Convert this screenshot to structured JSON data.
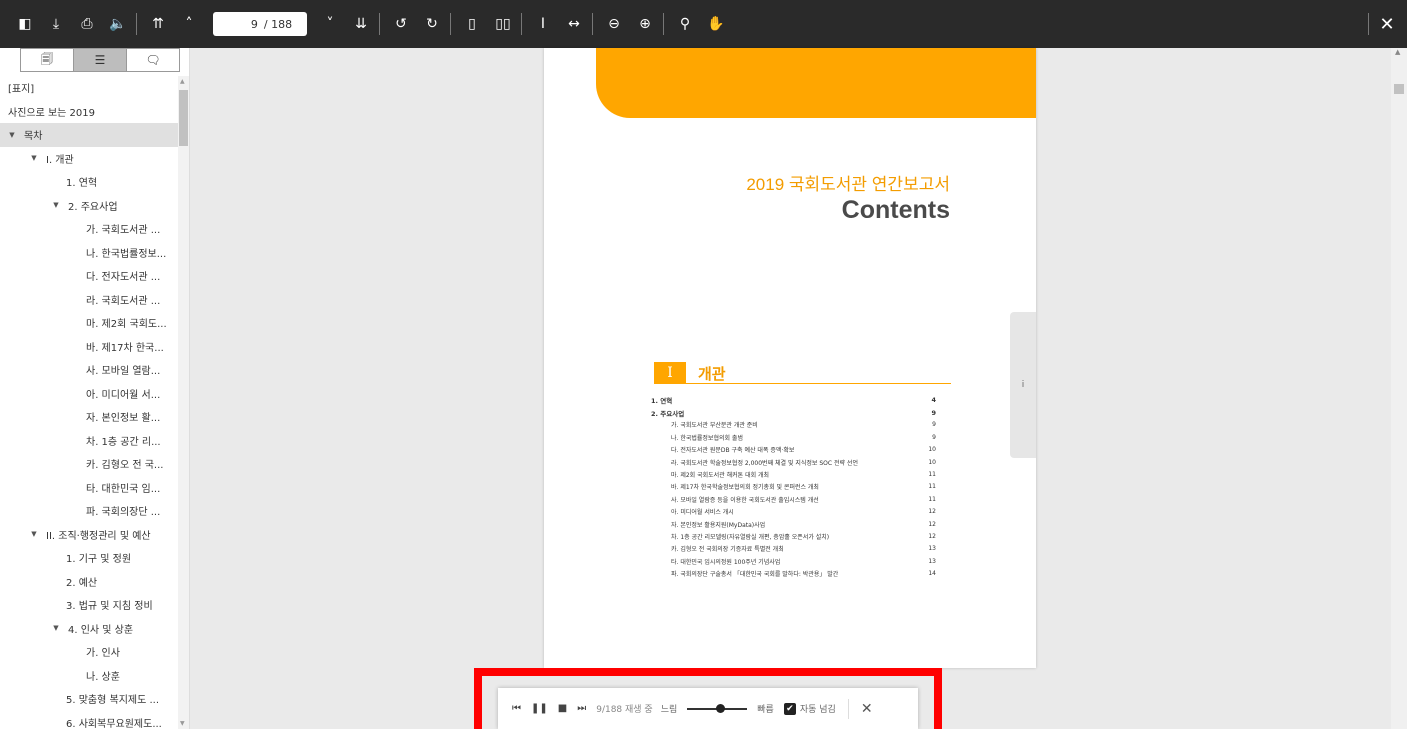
{
  "toolbar": {
    "page_current": "9",
    "page_total": "/ 188",
    "left_icons": [
      "sidebar-toggle-icon",
      "download-icon",
      "print-icon",
      "speaker-icon",
      "first-page-icon",
      "previous-page-icon"
    ],
    "right_icons": [
      "next-page-icon",
      "last-page-icon",
      "rotate-counterclockwise-icon",
      "rotate-clockwise-icon",
      "single-page-icon",
      "two-page-icon",
      "fit-height-icon",
      "fit-width-icon",
      "zoom-out-icon",
      "zoom-in-icon",
      "search-icon",
      "hand-tool-icon"
    ],
    "glyphs": {
      "sidebar-toggle-icon": "◧",
      "download-icon": "⤓",
      "print-icon": "⎙",
      "speaker-icon": "🔈",
      "first-page-icon": "⇈",
      "previous-page-icon": "˄",
      "next-page-icon": "˅",
      "last-page-icon": "⇊",
      "rotate-counterclockwise-icon": "↺",
      "rotate-clockwise-icon": "↻",
      "single-page-icon": "▯",
      "two-page-icon": "▯▯",
      "fit-height-icon": "Ⅰ",
      "fit-width-icon": "↔",
      "zoom-out-icon": "⊖",
      "zoom-in-icon": "⊕",
      "search-icon": "⚲",
      "hand-tool-icon": "✋"
    },
    "close_icon": "✕"
  },
  "sidebar": {
    "tabs": [
      {
        "name": "thumbnails-tab-icon",
        "glyph": "🗐"
      },
      {
        "name": "outline-tab-icon",
        "glyph": "☰",
        "active": true
      },
      {
        "name": "annotations-tab-icon",
        "glyph": "🗨"
      }
    ],
    "items": [
      {
        "label": "[표지]",
        "level": 0
      },
      {
        "label": "사진으로 보는 2019",
        "level": 0
      },
      {
        "label": "목차",
        "level": 0,
        "caret": true,
        "selected": true
      },
      {
        "label": "I. 개관",
        "level": 1,
        "caret": true
      },
      {
        "label": "1. 연혁",
        "level": 3
      },
      {
        "label": "2. 주요사업",
        "level": 2,
        "caret": true
      },
      {
        "label": "가. 국회도서관 ...",
        "level": 4
      },
      {
        "label": "나. 한국법률정보...",
        "level": 4
      },
      {
        "label": "다. 전자도서관 ...",
        "level": 4
      },
      {
        "label": "라. 국회도서관 ...",
        "level": 4
      },
      {
        "label": "마. 제2회 국회도...",
        "level": 4
      },
      {
        "label": "바. 제17차 한국...",
        "level": 4
      },
      {
        "label": "사. 모바일 열람...",
        "level": 4
      },
      {
        "label": "아. 미디어월 서...",
        "level": 4
      },
      {
        "label": "자. 본인정보 활...",
        "level": 4
      },
      {
        "label": "차. 1층 공간 리...",
        "level": 4
      },
      {
        "label": "카. 김형오 전 국...",
        "level": 4
      },
      {
        "label": "타. 대한민국 임...",
        "level": 4
      },
      {
        "label": "파. 국회의장단 ...",
        "level": 4
      },
      {
        "label": "II. 조직·행정관리 및 예산",
        "level": 1,
        "caret": true
      },
      {
        "label": "1. 기구 및 정원",
        "level": 3
      },
      {
        "label": "2. 예산",
        "level": 3
      },
      {
        "label": "3. 법규 및 지침 정비",
        "level": 3
      },
      {
        "label": "4. 인사 및 상훈",
        "level": 2,
        "caret": true
      },
      {
        "label": "가. 인사",
        "level": 4
      },
      {
        "label": "나. 상훈",
        "level": 4
      },
      {
        "label": "5. 맞춤형 복지제도 ...",
        "level": 3
      },
      {
        "label": "6. 사회복무요원제도...",
        "level": 3
      }
    ]
  },
  "page": {
    "report_title": "2019 국회도서관 연간보고서",
    "contents_title": "Contents",
    "section_number": "I",
    "section_title": "개관",
    "entries": [
      {
        "title": "1. 연혁",
        "page": "4",
        "bold": true
      },
      {
        "title": "2. 주요사업",
        "page": "9",
        "bold": true
      },
      {
        "title": "가. 국회도서관 부산분관 개관 준비",
        "page": "9"
      },
      {
        "title": "나. 한국법률정보협의회 출범",
        "page": "9"
      },
      {
        "title": "다. 전자도서관 원문DB 구축 예산 대폭 증액·확보",
        "page": "10"
      },
      {
        "title": "라. 국회도서관 학술정보협정 2,000번째 체결 및 지식정보 SOC 전략 선언",
        "page": "10"
      },
      {
        "title": "마. 제2회 국회도서관 해커톤 대회 개최",
        "page": "11"
      },
      {
        "title": "바. 제17차 한국학술정보협의회 정기총회 및 콘퍼런스 개최",
        "page": "11"
      },
      {
        "title": "사. 모바일 열람증 등을 이용한 국회도서관 출입시스템 개선",
        "page": "11"
      },
      {
        "title": "아. 미디어월 서비스 개시",
        "page": "12"
      },
      {
        "title": "자. 본인정보 활용지원(MyData)사업",
        "page": "12"
      },
      {
        "title": "차. 1층 공간 리모델링(자유열람실 개편, 층암홀 오픈서가 설치)",
        "page": "12"
      },
      {
        "title": "카. 김형오 전 국회의장 기증자료 특별전 개최",
        "page": "13"
      },
      {
        "title": "타. 대한민국 임시의정원 100주년 기념사업",
        "page": "13"
      },
      {
        "title": "파. 국회의장단 구술총서 「대한민국 국회를 말하다: 박관용」 발간",
        "page": "14"
      }
    ],
    "side_tab_glyph": "i"
  },
  "player": {
    "first_icon": "⏮",
    "pause_icon": "❚❚",
    "stop_icon": "■",
    "last_icon": "⏭",
    "status": "9/188 재생 중",
    "slow_label": "느림",
    "fast_label": "빠름",
    "auto_label": "자동 넘김",
    "auto_checked": true,
    "speed_level": 0.55,
    "check_glyph": "✔",
    "close_glyph": "✕"
  },
  "colors": {
    "accent": "#ffa600",
    "toolbar": "#2a2a2a",
    "highlight": "#ff0000"
  }
}
